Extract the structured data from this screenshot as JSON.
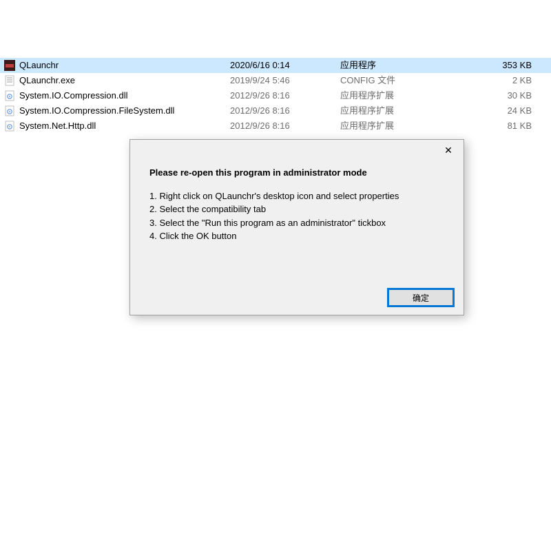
{
  "files": [
    {
      "name": "QLaunchr",
      "date": "2020/6/16 0:14",
      "type": "应用程序",
      "size": "353 KB",
      "icon": "exe",
      "selected": true
    },
    {
      "name": "QLaunchr.exe",
      "date": "2019/9/24 5:46",
      "type": "CONFIG 文件",
      "size": "2 KB",
      "icon": "config",
      "selected": false
    },
    {
      "name": "System.IO.Compression.dll",
      "date": "2012/9/26 8:16",
      "type": "应用程序扩展",
      "size": "30 KB",
      "icon": "dll",
      "selected": false
    },
    {
      "name": "System.IO.Compression.FileSystem.dll",
      "date": "2012/9/26 8:16",
      "type": "应用程序扩展",
      "size": "24 KB",
      "icon": "dll",
      "selected": false
    },
    {
      "name": "System.Net.Http.dll",
      "date": "2012/9/26 8:16",
      "type": "应用程序扩展",
      "size": "81 KB",
      "icon": "dll",
      "selected": false
    }
  ],
  "dialog": {
    "headline": "Please re-open this program in administrator mode",
    "lines": [
      "1. Right click on QLaunchr's desktop icon and select properties",
      "2. Select the compatibility tab",
      "3. Select the \"Run this program as an administrator\" tickbox",
      "4. Click the OK button"
    ],
    "ok": "确定",
    "close": "✕"
  }
}
